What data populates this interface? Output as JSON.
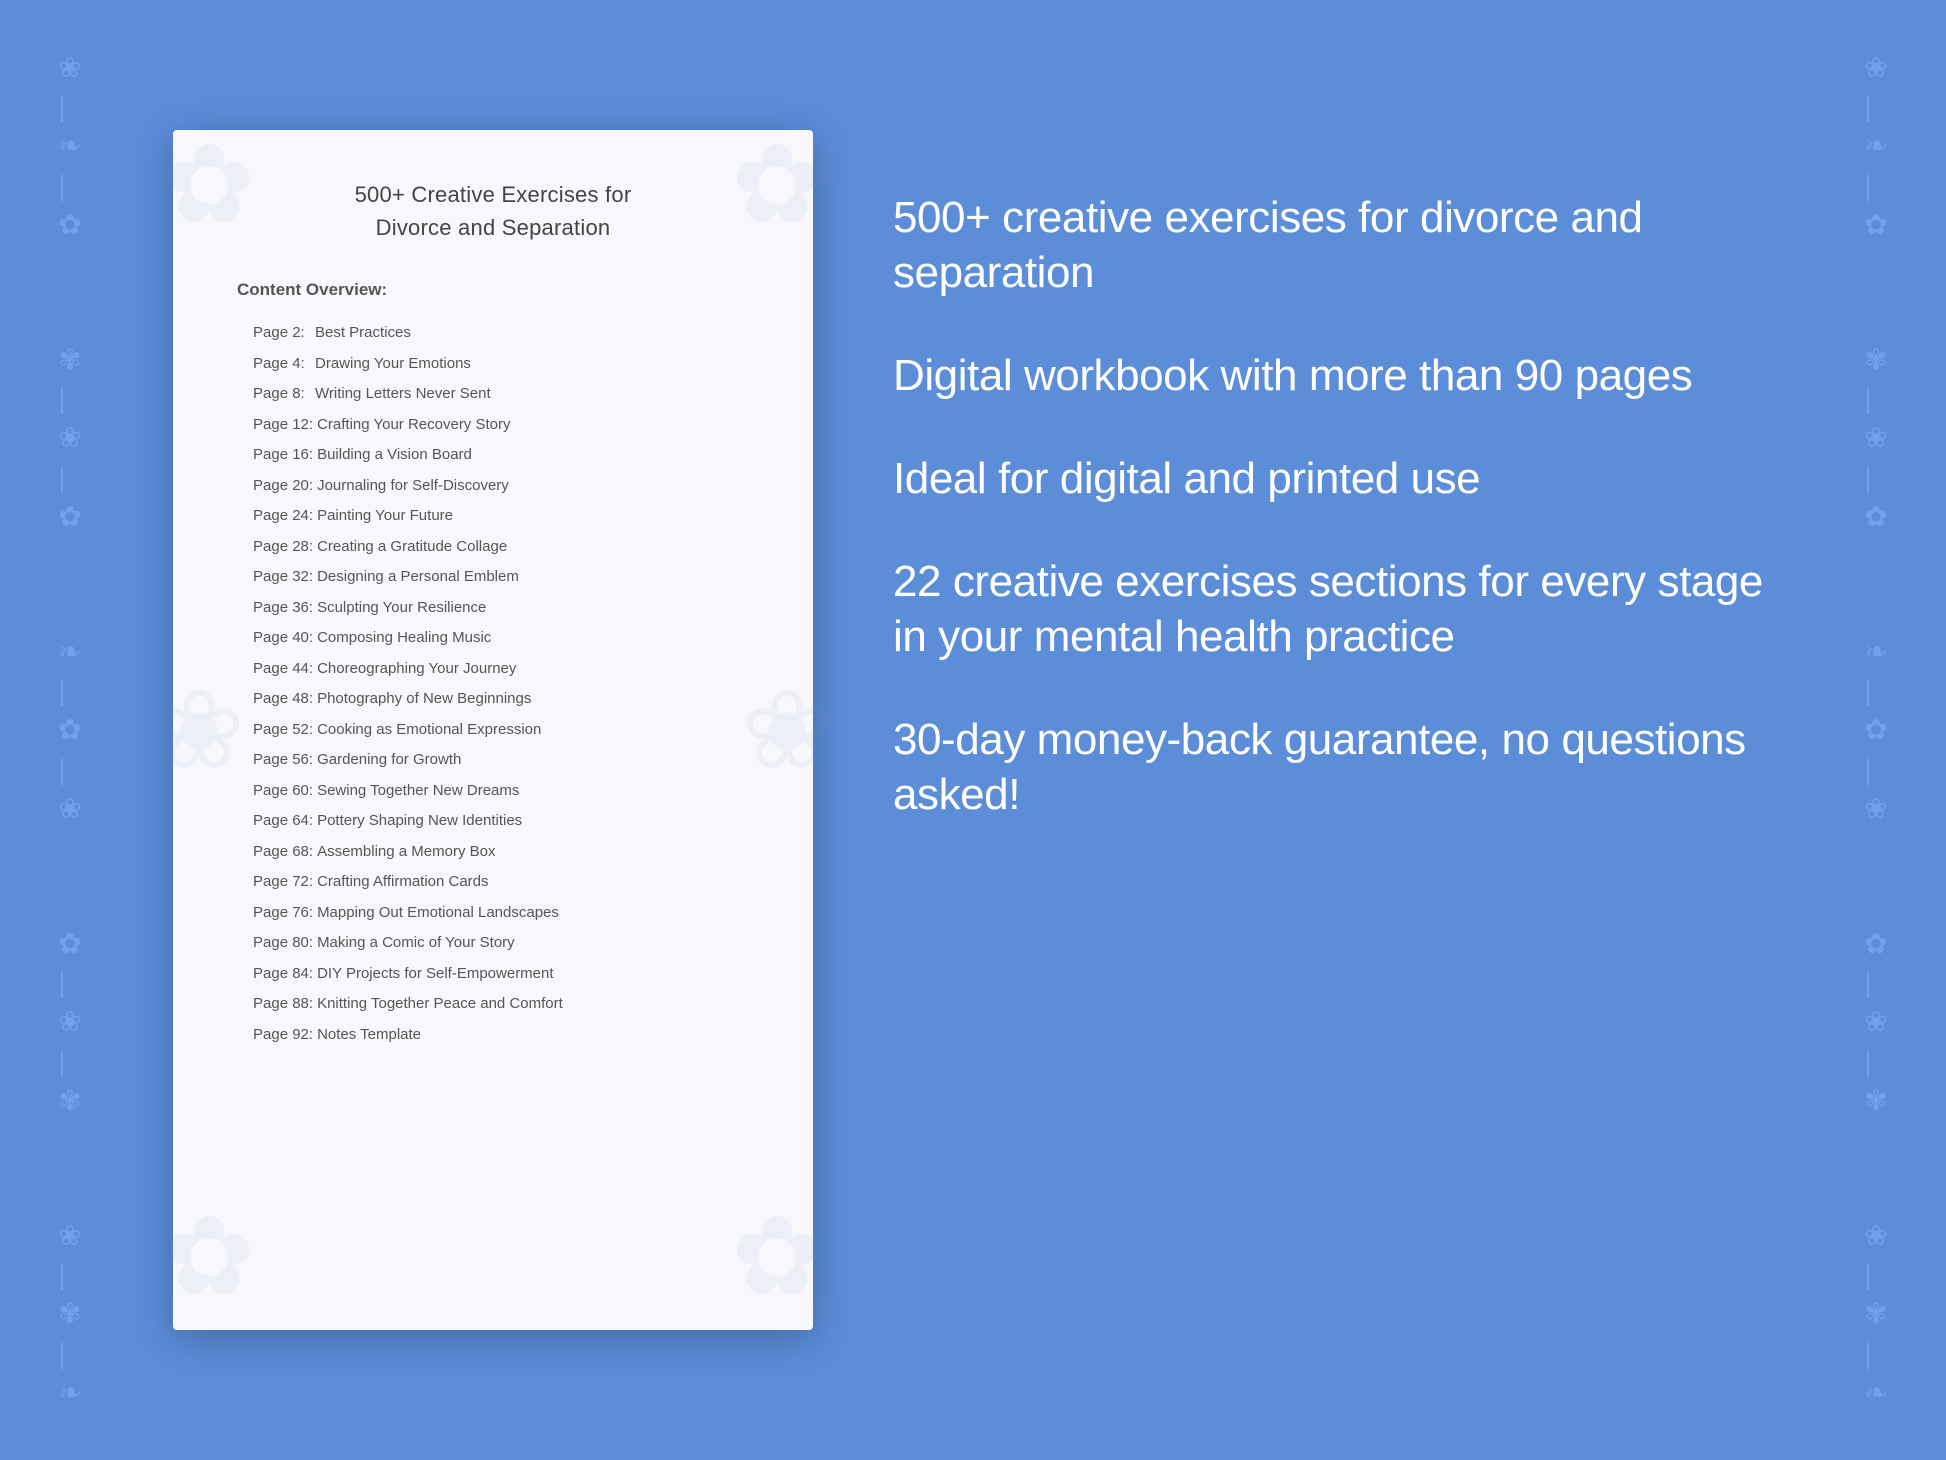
{
  "background_color": "#5b8dd9",
  "document": {
    "title_line1": "500+ Creative Exercises for",
    "title_line2": "Divorce and Separation",
    "section_label": "Content Overview:",
    "toc_items": [
      {
        "page": "Page  2:",
        "title": "Best Practices"
      },
      {
        "page": "Page  4:",
        "title": "Drawing Your Emotions"
      },
      {
        "page": "Page  8:",
        "title": "Writing Letters Never Sent"
      },
      {
        "page": "Page 12:",
        "title": "Crafting Your Recovery Story"
      },
      {
        "page": "Page 16:",
        "title": "Building a Vision Board"
      },
      {
        "page": "Page 20:",
        "title": "Journaling for Self-Discovery"
      },
      {
        "page": "Page 24:",
        "title": "Painting Your Future"
      },
      {
        "page": "Page 28:",
        "title": "Creating a Gratitude Collage"
      },
      {
        "page": "Page 32:",
        "title": "Designing a Personal Emblem"
      },
      {
        "page": "Page 36:",
        "title": "Sculpting Your Resilience"
      },
      {
        "page": "Page 40:",
        "title": "Composing Healing Music"
      },
      {
        "page": "Page 44:",
        "title": "Choreographing Your Journey"
      },
      {
        "page": "Page 48:",
        "title": "Photography of New Beginnings"
      },
      {
        "page": "Page 52:",
        "title": "Cooking as Emotional Expression"
      },
      {
        "page": "Page 56:",
        "title": "Gardening for Growth"
      },
      {
        "page": "Page 60:",
        "title": "Sewing Together New Dreams"
      },
      {
        "page": "Page 64:",
        "title": "Pottery Shaping New Identities"
      },
      {
        "page": "Page 68:",
        "title": "Assembling a Memory Box"
      },
      {
        "page": "Page 72:",
        "title": "Crafting Affirmation Cards"
      },
      {
        "page": "Page 76:",
        "title": "Mapping Out Emotional Landscapes"
      },
      {
        "page": "Page 80:",
        "title": "Making a Comic of Your Story"
      },
      {
        "page": "Page 84:",
        "title": "DIY Projects for Self-Empowerment"
      },
      {
        "page": "Page 88:",
        "title": "Knitting Together Peace and Comfort"
      },
      {
        "page": "Page 92:",
        "title": "Notes Template"
      }
    ]
  },
  "features": [
    "500+ creative exercises for divorce and separation",
    "Digital workbook with more than 90 pages",
    "Ideal for digital and printed use",
    "22 creative exercises sections for every stage in your mental health practice",
    "30-day money-back guarantee, no questions asked!"
  ],
  "floral_icon": "❀",
  "watermark_icon": "✿"
}
